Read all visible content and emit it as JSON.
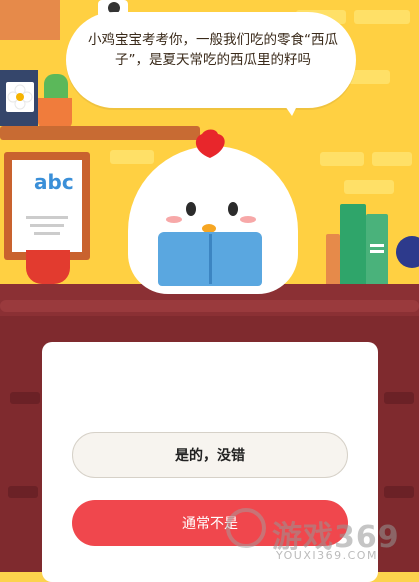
{
  "question": {
    "text": "小鸡宝宝考考你，一般我们吃的零食“西瓜子”，是夏天常吃的西瓜里的籽吗"
  },
  "options": [
    {
      "label": "是的，没错",
      "style": "neutral"
    },
    {
      "label": "通常不是",
      "style": "primary"
    }
  ],
  "poster_letters": "abc",
  "watermark": {
    "text": "游戏369",
    "url": "YOUXI369.COM"
  },
  "colors": {
    "wall": "#ffd042",
    "counter": "#7f2a2e",
    "primary_button": "#f0474d",
    "neutral_button": "#f7f4ef"
  },
  "icons": [
    "chick-mascot",
    "cactus-plant",
    "flower-frame",
    "red-cup",
    "books",
    "globe",
    "camera"
  ]
}
